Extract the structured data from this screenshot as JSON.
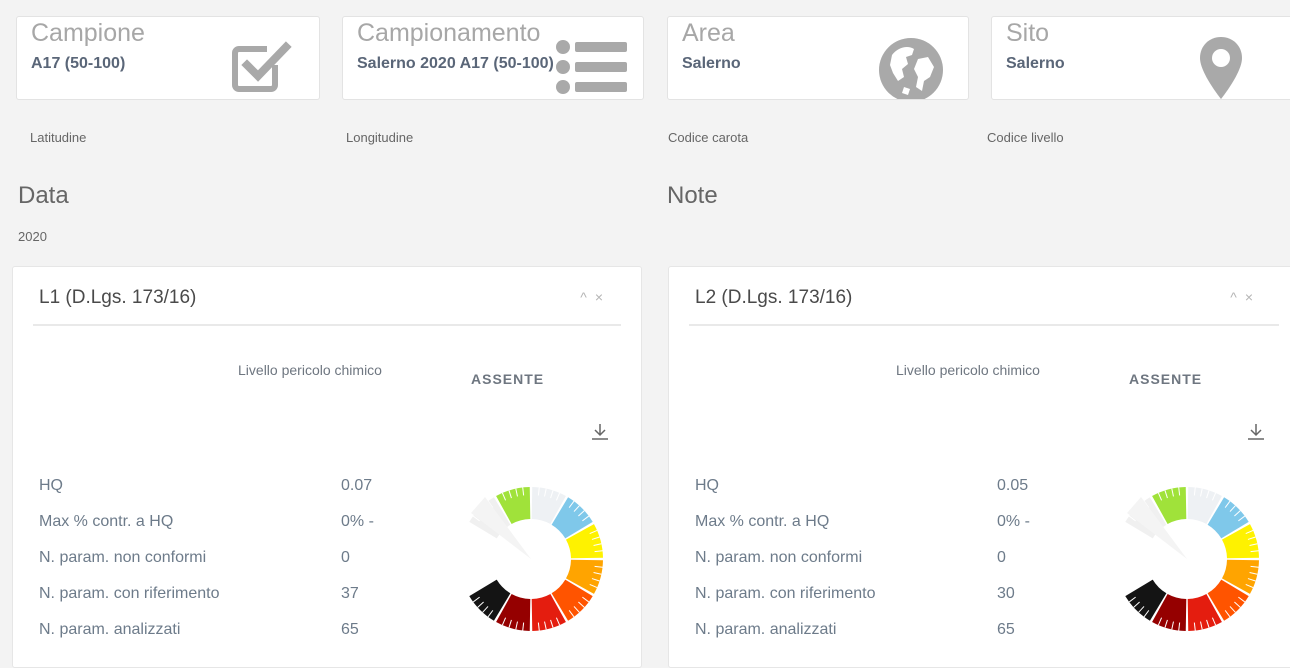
{
  "cards": [
    {
      "title": "Campione",
      "value": "A17 (50-100)",
      "icon": "checkbox-icon"
    },
    {
      "title": "Campionamento",
      "value": "Salerno 2020 A17 (50-100)",
      "icon": "list-icon"
    },
    {
      "title": "Area",
      "value": "Salerno",
      "icon": "globe-icon"
    },
    {
      "title": "Sito",
      "value": "Salerno",
      "icon": "map-pin-icon"
    }
  ],
  "fields": {
    "latitudine": "Latitudine",
    "longitudine": "Longitudine",
    "codice_carota": "Codice carota",
    "codice_livello": "Codice livello"
  },
  "data_section": {
    "label": "Data",
    "value": "2020"
  },
  "note_section": {
    "label": "Note"
  },
  "panels": [
    {
      "title": "L1 (D.Lgs. 173/16)",
      "level_label": "Livello pericolo chimico",
      "level_value": "ASSENTE",
      "stats": [
        {
          "label": "HQ",
          "value": "0.07"
        },
        {
          "label": "Max % contr. a HQ",
          "value": "0% -"
        },
        {
          "label": "N. param. non conformi",
          "value": "0"
        },
        {
          "label": "N. param. con riferimento",
          "value": "37"
        },
        {
          "label": "N. param. analizzati",
          "value": "65"
        }
      ]
    },
    {
      "title": "L2 (D.Lgs. 173/16)",
      "level_label": "Livello pericolo chimico",
      "level_value": "ASSENTE",
      "stats": [
        {
          "label": "HQ",
          "value": "0.05"
        },
        {
          "label": "Max % contr. a HQ",
          "value": "0% -"
        },
        {
          "label": "N. param. non conformi",
          "value": "0"
        },
        {
          "label": "N. param. con riferimento",
          "value": "30"
        },
        {
          "label": "N. param. analizzati",
          "value": "65"
        }
      ]
    }
  ],
  "panel_tools": {
    "collapse": "^",
    "close": "×"
  },
  "gauge_colors": [
    "#f0f0f0",
    "#a0e23a",
    "#eef1f4",
    "#7fc8ea",
    "#fef200",
    "#ffa400",
    "#ff5400",
    "#e41d0f",
    "#950000",
    "#141414"
  ]
}
